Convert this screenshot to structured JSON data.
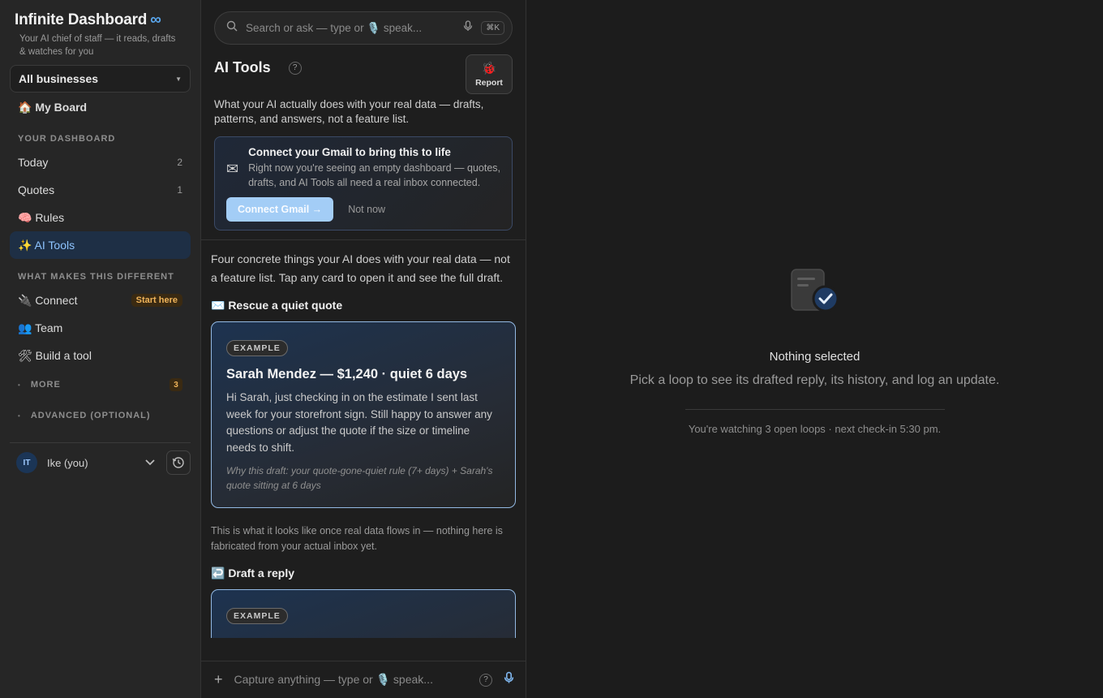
{
  "sidebar": {
    "brand": "Infinite Dashboard",
    "brand_symbol": "∞",
    "tagline": "Your AI chief of staff — it reads, drafts & watches for you",
    "business_select": "All businesses",
    "my_board": "🏠 My Board",
    "section_dashboard": "YOUR DASHBOARD",
    "dashboard_items": [
      {
        "label": "Today",
        "count": "2"
      },
      {
        "label": "Quotes",
        "count": "1"
      },
      {
        "label": "🧠 Rules",
        "count": ""
      },
      {
        "label": "✨ AI Tools",
        "count": ""
      }
    ],
    "section_different": "WHAT MAKES THIS DIFFERENT",
    "different_items": [
      {
        "label": "🔌 Connect",
        "badge": "Start here"
      },
      {
        "label": "👥 Team"
      },
      {
        "label": "🛠 Build a tool"
      }
    ],
    "more_label": "MORE",
    "more_count": "3",
    "advanced_label": "ADVANCED (OPTIONAL)",
    "user_initials": "IT",
    "user_name": "Ike (you)"
  },
  "middle": {
    "search_placeholder": "Search or ask — type or 🎙️ speak...",
    "search_shortcut": "⌘K",
    "title": "AI Tools",
    "help": "?",
    "report_icon": "🐞",
    "report_label": "Report",
    "intro": "What your AI actually does with your real data — drafts, patterns, and answers, not a feature list.",
    "gmail_card": {
      "icon": "✉",
      "title": "Connect your Gmail to bring this to life",
      "body": "Right now you're seeing an empty dashboard — quotes, drafts, and AI Tools all need a real inbox connected.",
      "connect_label": "Connect Gmail →",
      "not_now_label": "Not now"
    },
    "lead": "Four concrete things your AI does with your real data — not a feature list. Tap any card to open it and see the full draft.",
    "rescue_head": "✉️ Rescue a quiet quote",
    "example_pill": "EXAMPLE",
    "example_title": "Sarah Mendez — $1,240 · quiet 6 days",
    "example_body": "Hi Sarah, just checking in on the estimate I sent last week for your storefront sign. Still happy to answer any questions or adjust the quote if the size or timeline needs to shift.",
    "example_why": "Why this draft: your quote-gone-quiet rule (7+ days) + Sarah's quote sitting at 6 days",
    "note": "This is what it looks like once real data flows in — nothing here is fabricated from your actual inbox yet.",
    "draft_head": "↩️ Draft a reply",
    "example_pill_2": "EXAMPLE",
    "capture_placeholder": "Capture anything — type or 🎙️ speak...",
    "capture_plus": "+",
    "capture_help": "?"
  },
  "right": {
    "empty_title": "Nothing selected",
    "empty_sub": "Pick a loop to see its drafted reply, its history, and log an update.",
    "status": "You're watching 3 open loops · next check-in 5:30 pm."
  },
  "colors": {
    "accent": "#5aa7ee",
    "active_bg": "#1e2f45",
    "badge": "#f0b45a",
    "card_border": "#93b9e3"
  }
}
